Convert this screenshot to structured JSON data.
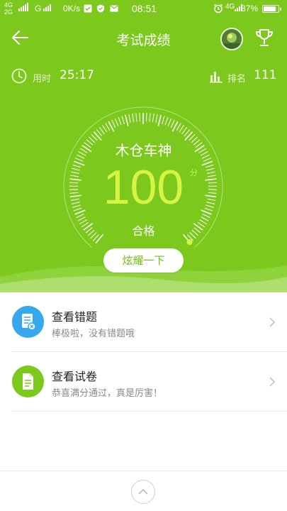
{
  "status_bar": {
    "net_top": "4G",
    "net_bottom": "2G",
    "net2": "G",
    "speed": "0K/s",
    "time": "08:51",
    "network_type": "4G",
    "battery": "87%",
    "battery_level": 0.87
  },
  "header": {
    "title": "考试成绩"
  },
  "stats": {
    "time_label": "用时",
    "time_value": "25:17",
    "rank_label": "排名",
    "rank_value": "111"
  },
  "result": {
    "rank_title": "木仓车神",
    "score": "100",
    "score_unit": "分",
    "score_fraction": 1.0,
    "verdict": "合格",
    "share_label": "炫耀一下"
  },
  "list": [
    {
      "title": "查看错题",
      "subtitle": "棒极啦，没有错题哦",
      "icon": "wrong-questions-icon",
      "color": "#35a8ee"
    },
    {
      "title": "查看试卷",
      "subtitle": "恭喜满分通过，真是厉害！",
      "icon": "exam-paper-icon",
      "color": "#7cc81c"
    }
  ],
  "colors": {
    "brand_green": "#7cc81c",
    "score_yellow": "#d6f542",
    "blue": "#35a8ee"
  }
}
